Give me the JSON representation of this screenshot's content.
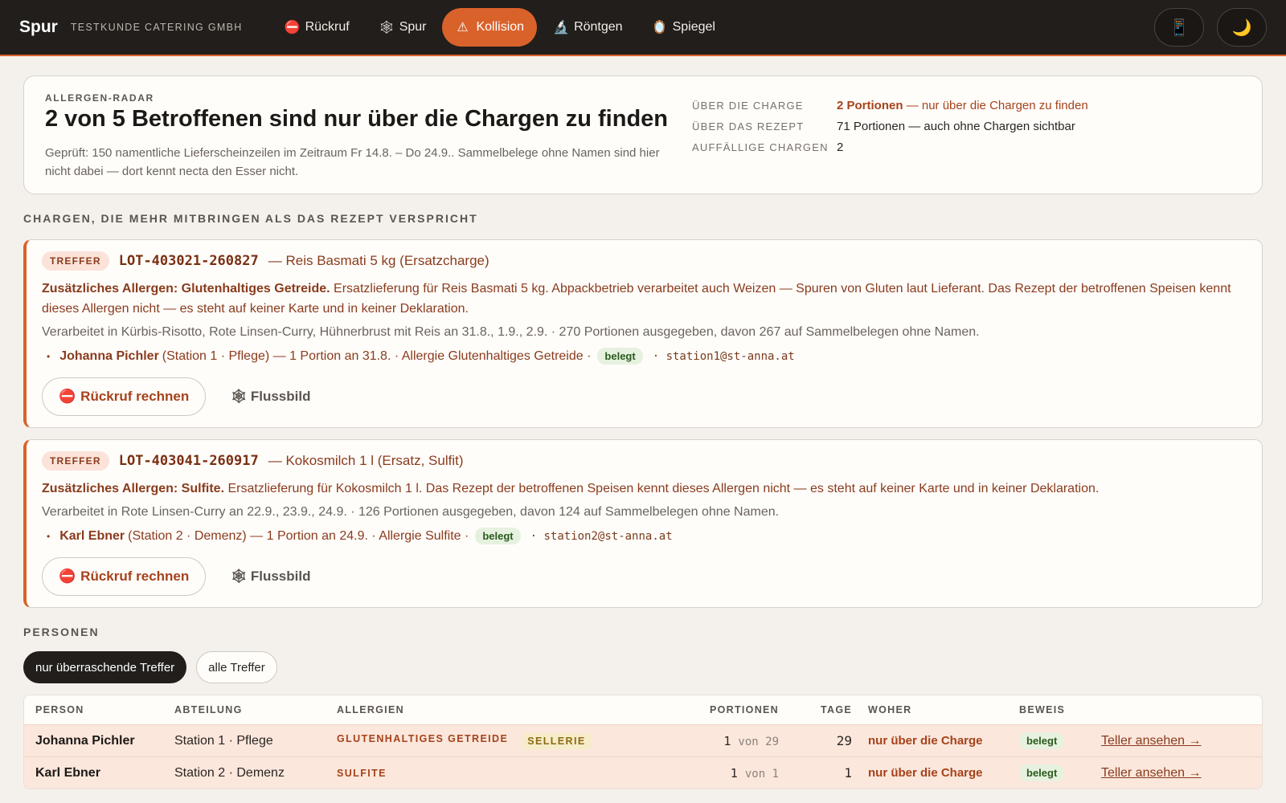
{
  "topbar": {
    "brand": "Spur",
    "customer": "TESTKUNDE CATERING GMBH",
    "nav": [
      {
        "icon": "⛔",
        "label": "Rückruf",
        "active": false
      },
      {
        "icon": "🕸",
        "label": "Spur",
        "active": false
      },
      {
        "icon": "⚠",
        "label": "Kollision",
        "active": true
      },
      {
        "icon": "🔬",
        "label": "Röntgen",
        "active": false
      },
      {
        "icon": "🪞",
        "label": "Spiegel",
        "active": false
      }
    ],
    "phone_icon": "📱",
    "theme_icon": "🌙"
  },
  "summary": {
    "eyebrow": "ALLERGEN-RADAR",
    "title": "2 von 5 Betroffenen sind nur über die Chargen zu finden",
    "description": "Geprüft: 150 namentliche Lieferscheinzeilen im Zeitraum Fr 14.8. – Do 24.9.. Sammelbelege ohne Namen sind hier nicht dabei — dort kennt necta den Esser nicht.",
    "stats": {
      "charge_label": "ÜBER DIE CHARGE",
      "charge_value_strong": "2 Portionen",
      "charge_value_rest": " — nur über die Chargen zu finden",
      "rezept_label": "ÜBER DAS REZEPT",
      "rezept_value": "71 Portionen — auch ohne Chargen sichtbar",
      "auffaellig_label": "AUFFÄLLIGE CHARGEN",
      "auffaellig_value": "2"
    }
  },
  "section_chargen": "CHARGEN, DIE MEHR MITBRINGEN ALS DAS REZEPT VERSPRICHT",
  "hits": [
    {
      "badge": "TREFFER",
      "lot": "LOT-403021-260827",
      "lot_desc": "— Reis Basmati 5 kg (Ersatzcharge)",
      "allergen_strong": "Zusätzliches Allergen: Glutenhaltiges Getreide.",
      "allergen_text": " Ersatzlieferung für Reis Basmati 5 kg. Abpackbetrieb verarbeitet auch Weizen — Spuren von Gluten laut Lieferant. Das Rezept der betroffenen Speisen kennt dieses Allergen nicht — es steht auf keiner Karte und in keiner Deklaration.",
      "usage": "Verarbeitet in Kürbis-Risotto, Rote Linsen-Curry, Hühnerbrust mit Reis an 31.8., 1.9., 2.9. · 270 Portionen ausgegeben, davon 267 auf Sammelbelegen ohne Namen.",
      "person_name": "Johanna Pichler",
      "person_detail": "(Station 1 · Pflege) — 1 Portion an 31.8. · Allergie Glutenhaltiges Getreide ·",
      "belegt": "belegt",
      "email": "· station1@st-anna.at",
      "btn_rueckruf": "Rückruf rechnen",
      "btn_fluss": "Flussbild"
    },
    {
      "badge": "TREFFER",
      "lot": "LOT-403041-260917",
      "lot_desc": "— Kokosmilch 1 l (Ersatz, Sulfit)",
      "allergen_strong": "Zusätzliches Allergen: Sulfite.",
      "allergen_text": " Ersatzlieferung für Kokosmilch 1 l. Das Rezept der betroffenen Speisen kennt dieses Allergen nicht — es steht auf keiner Karte und in keiner Deklaration.",
      "usage": "Verarbeitet in Rote Linsen-Curry an 22.9., 23.9., 24.9. · 126 Portionen ausgegeben, davon 124 auf Sammelbelegen ohne Namen.",
      "person_name": "Karl Ebner",
      "person_detail": "(Station 2 · Demenz) — 1 Portion an 24.9. · Allergie Sulfite ·",
      "belegt": "belegt",
      "email": "· station2@st-anna.at",
      "btn_rueckruf": "Rückruf rechnen",
      "btn_fluss": "Flussbild"
    }
  ],
  "section_personen": "PERSONEN",
  "filters": [
    {
      "label": "nur überraschende Treffer",
      "active": true
    },
    {
      "label": "alle Treffer",
      "active": false
    }
  ],
  "table": {
    "headers": [
      "PERSON",
      "ABTEILUNG",
      "ALLERGIEN",
      "PORTIONEN",
      "TAGE",
      "WOHER",
      "BEWEIS",
      ""
    ],
    "rows": [
      {
        "person": "Johanna Pichler",
        "dept": "Station 1 · Pflege",
        "allergen1": "GLUTENHALTIGES GETREIDE",
        "allergen2": "SELLERIE",
        "portions": "1",
        "portions_von": "von 29",
        "tage": "29",
        "woher": "nur über die Charge",
        "beweis": "belegt",
        "link": "Teller ansehen →"
      },
      {
        "person": "Karl Ebner",
        "dept": "Station 2 · Demenz",
        "allergen1": "SULFITE",
        "allergen2": "",
        "portions": "1",
        "portions_von": "von 1",
        "tage": "1",
        "woher": "nur über die Charge",
        "beweis": "belegt",
        "link": "Teller ansehen →"
      }
    ]
  }
}
